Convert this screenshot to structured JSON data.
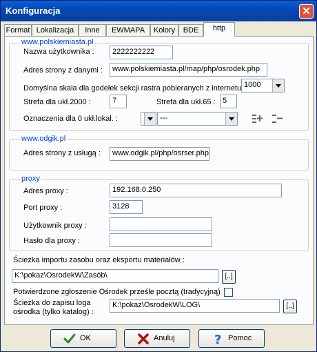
{
  "window": {
    "title": "Konfiguracja",
    "close": "✕"
  },
  "tabs": [
    "Format",
    "Lokalizacja",
    "Inne",
    "EWMAPA",
    "Kolory",
    "BDE",
    "http"
  ],
  "group1": {
    "legend": "www.polskiemiasta.pl",
    "username_label": "Nazwa użytkownika :",
    "username_value": "2222222222",
    "url_label": "Adres strony z danymi :",
    "url_value": "www.polskiemiasta.pl/map/php/osrodek.php",
    "scale_label": "Domyślna skala dla godełek sekcji rastra pobieranych z internetu",
    "scale_value": "1000",
    "zone2000_label": "Strefa dla ukł.2000 :",
    "zone2000_value": "7",
    "zone65_label": "Strefa dla ukł.65 :",
    "zone65_value": "5",
    "marks_label": "Oznaczenia dla 0   ukł.lokal. :",
    "marks_combo1": "",
    "marks_combo2": "---"
  },
  "group2": {
    "legend": "www.odgik.pl",
    "url_label": "Adres strony z usługą :",
    "url_value": "www.odgik.pl/php/osrser.php"
  },
  "group3": {
    "legend": "proxy",
    "address_label": "Adres proxy :",
    "address_value": "192.168.0.250",
    "port_label": "Port proxy :",
    "port_value": "3128",
    "user_label": "Użytkownik  proxy :",
    "user_value": "",
    "password_label": "Hasło dla proxy :",
    "password_value": ""
  },
  "import": {
    "label": "Ścieżka importu zasobu oraz eksportu materiałów :",
    "value": "K:\\pokaz\\OsrodekW\\Zasób\\",
    "browse": "[..]"
  },
  "confirm": {
    "label": "Potwierdzone zgłoszenie Ośrodek prześle pocztą (tradycyjną)",
    "checked": false
  },
  "log": {
    "label_line1": "Ścieżka do zapisu loga",
    "label_line2": "ośrodka (tylko katalog) :",
    "value": "K:\\pokaz\\OsrodekW\\LOG\\",
    "browse": "[..]"
  },
  "buttons": {
    "ok": "OK",
    "cancel": "Anuluj",
    "help": "Pomoc"
  },
  "colors": {
    "title_bar": "#0548b5",
    "legend_text": "#0046d5",
    "ok_icon": "#2a8a1a",
    "cancel_icon": "#b01010",
    "help_icon": "#2a5ad8"
  },
  "icons": [
    "close-icon",
    "chevron-down-icon",
    "add-mark-icon",
    "remove-mark-icon",
    "checkmark-icon",
    "x-icon",
    "question-icon"
  ]
}
